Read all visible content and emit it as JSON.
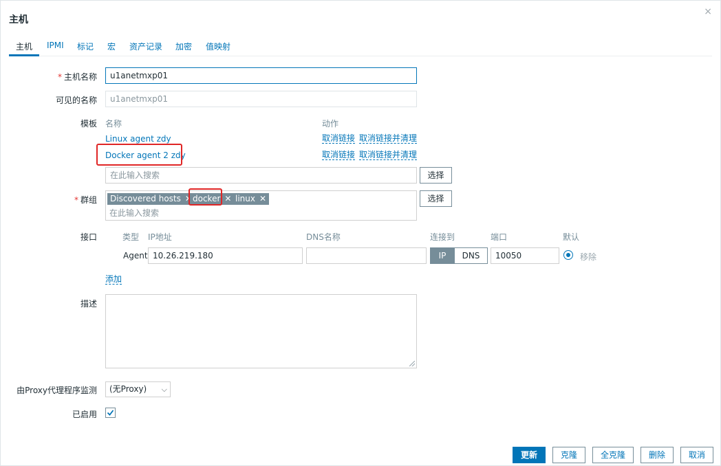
{
  "dialog": {
    "title": "主机",
    "close_icon": "×"
  },
  "tabs": [
    "主机",
    "IPMI",
    "标记",
    "宏",
    "资产记录",
    "加密",
    "值映射"
  ],
  "form": {
    "hostname": {
      "label": "主机名称",
      "value": "u1anetmxp01"
    },
    "visible_name": {
      "label": "可见的名称",
      "placeholder": "u1anetmxp01"
    },
    "templates": {
      "label": "模板",
      "col_name": "名称",
      "col_action": "动作",
      "rows": [
        {
          "name": "Linux agent zdy",
          "unlink": "取消链接",
          "unlink_clear": "取消链接并清理"
        },
        {
          "name": "Docker agent 2 zdy",
          "unlink": "取消链接",
          "unlink_clear": "取消链接并清理"
        }
      ],
      "search_placeholder": "在此输入搜索",
      "select_button": "选择"
    },
    "groups": {
      "label": "群组",
      "tags": [
        "Discovered hosts",
        "docker",
        "linux"
      ],
      "search_placeholder": "在此输入搜索",
      "select_button": "选择"
    },
    "interfaces": {
      "label": "接口",
      "headers": {
        "type": "类型",
        "ip": "IP地址",
        "dns": "DNS名称",
        "connect": "连接到",
        "port": "端口",
        "default": "默认"
      },
      "row": {
        "type": "Agent",
        "ip": "10.26.219.180",
        "dns": "",
        "connect_ip": "IP",
        "connect_dns": "DNS",
        "port": "10050",
        "remove": "移除"
      },
      "add_link": "添加"
    },
    "description": {
      "label": "描述",
      "value": ""
    },
    "proxy": {
      "label": "由Proxy代理程序监测",
      "value": "(无Proxy)"
    },
    "enabled": {
      "label": "已启用",
      "checked": true
    }
  },
  "footer": {
    "update": "更新",
    "clone": "克隆",
    "full_clone": "全克隆",
    "delete": "删除",
    "cancel": "取消"
  },
  "colors": {
    "accent": "#0275b8",
    "highlight": "#e02525",
    "tag_bg": "#768d99"
  }
}
